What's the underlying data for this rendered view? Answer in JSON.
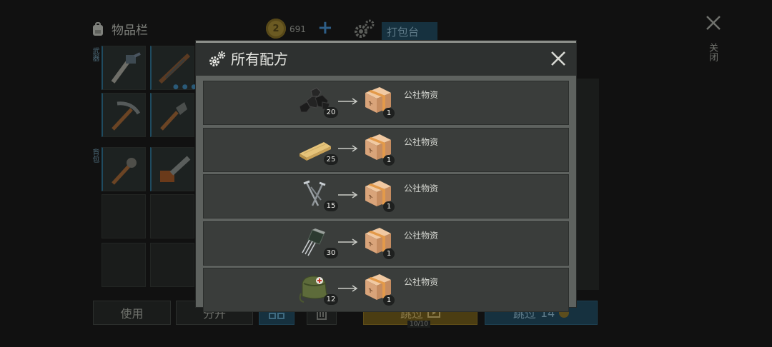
{
  "background": {
    "inventory_title": "物品栏",
    "coin_symbol": "2",
    "coin_count": "691",
    "plus_label": "+",
    "pack_tab_label": "打包台",
    "close_label": "关闭",
    "side_label_1": "武器",
    "side_label_2": "背包",
    "use_button": "使用",
    "split_button": "分开",
    "skip_ad_button": "跳过",
    "ad_counter": "10/10",
    "skip_coin_button": "跳过",
    "skip_coin_cost": "14"
  },
  "modal": {
    "title": "所有配方",
    "recipes": [
      {
        "input_icon": "coal-icon",
        "input_qty": "20",
        "output_icon": "supply-box-icon",
        "output_qty": "1",
        "output_name": "公社物资"
      },
      {
        "input_icon": "wood-plank-icon",
        "input_qty": "25",
        "output_icon": "supply-box-icon",
        "output_qty": "1",
        "output_name": "公社物资"
      },
      {
        "input_icon": "nails-icon",
        "input_qty": "15",
        "output_icon": "supply-box-icon",
        "output_qty": "1",
        "output_name": "公社物资"
      },
      {
        "input_icon": "transistor-icon",
        "input_qty": "30",
        "output_icon": "supply-box-icon",
        "output_qty": "1",
        "output_name": "公社物资"
      },
      {
        "input_icon": "medkit-bag-icon",
        "input_qty": "12",
        "output_icon": "supply-box-icon",
        "output_qty": "1",
        "output_name": "公社物资"
      }
    ]
  },
  "colors": {
    "modal_bg": "#5e625f",
    "header_bg": "#2e3130",
    "row_bg": "#3a3d3b",
    "box_orange": "#e39a4a"
  }
}
